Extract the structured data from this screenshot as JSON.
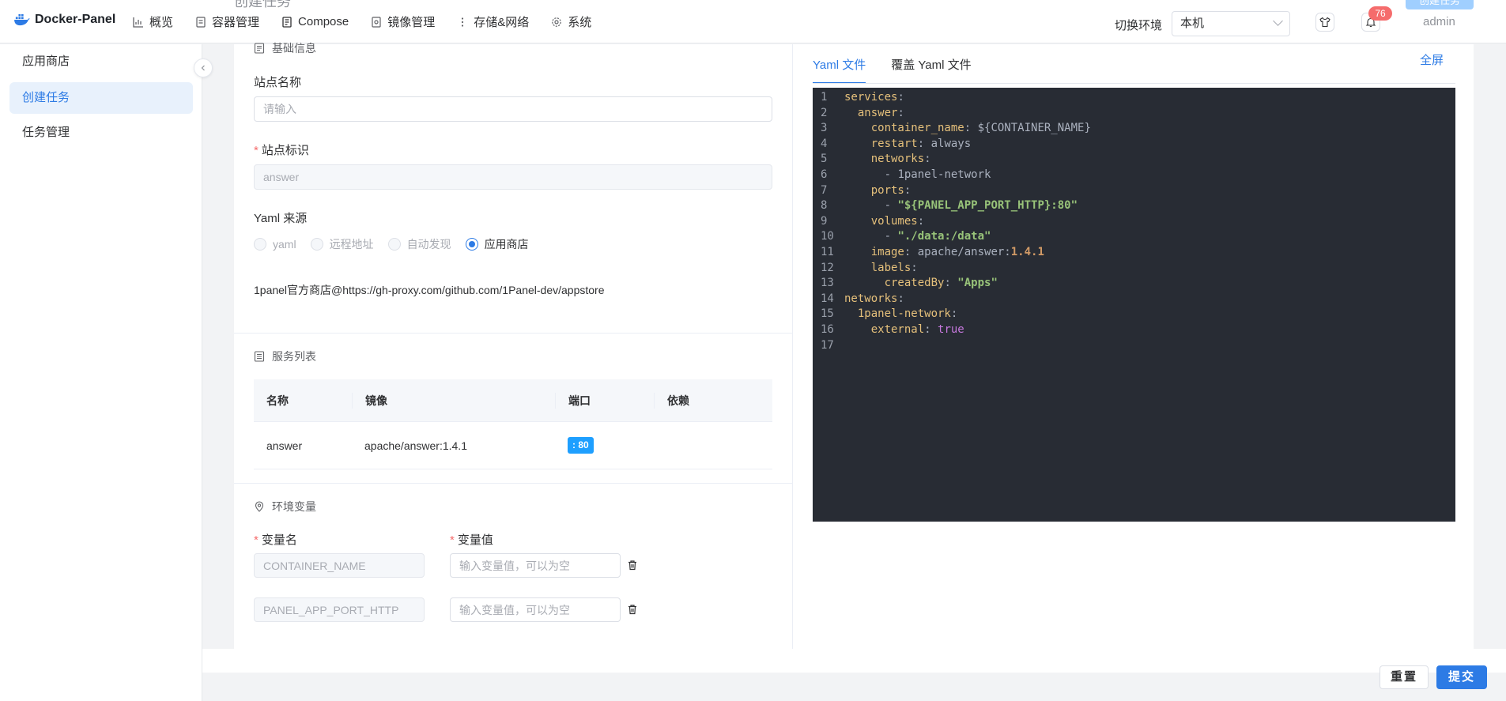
{
  "app": {
    "brand": "Docker-Panel",
    "page_title": "创建任务",
    "header_action": "创建任务"
  },
  "nav": [
    {
      "label": "概览",
      "icon": "chart-icon"
    },
    {
      "label": "容器管理",
      "icon": "container-icon"
    },
    {
      "label": "Compose",
      "icon": "compose-icon"
    },
    {
      "label": "镜像管理",
      "icon": "image-icon"
    },
    {
      "label": "存储&网络",
      "icon": "storage-icon"
    },
    {
      "label": "系统",
      "icon": "gear-icon"
    }
  ],
  "header": {
    "env_label": "切换环境",
    "env_value": "本机",
    "notification_count": "76",
    "user": "admin"
  },
  "sidebar": {
    "items": [
      {
        "label": "应用商店"
      },
      {
        "label": "创建任务"
      },
      {
        "label": "任务管理"
      }
    ]
  },
  "basic": {
    "section_title": "基础信息",
    "site_name_label": "站点名称",
    "site_name_placeholder": "请输入",
    "site_id_label": "站点标识",
    "site_id_value": "answer",
    "yaml_source_label": "Yaml 来源",
    "radios": [
      "yaml",
      "远程地址",
      "自动发现",
      "应用商店"
    ],
    "store_url": "1panel官方商店@https://gh-proxy.com/github.com/1Panel-dev/appstore"
  },
  "services": {
    "section_title": "服务列表",
    "headers": [
      "名称",
      "镜像",
      "端口",
      "依赖"
    ],
    "rows": [
      {
        "name": "answer",
        "image": "apache/answer:1.4.1",
        "port": ": 80",
        "depends": ""
      }
    ]
  },
  "env": {
    "section_title": "环境变量",
    "name_label": "变量名",
    "value_label": "变量值",
    "value_placeholder": "输入变量值，可以为空",
    "vars": [
      {
        "name": "CONTAINER_NAME"
      },
      {
        "name": "PANEL_APP_PORT_HTTP"
      }
    ]
  },
  "editor": {
    "tabs": [
      "Yaml 文件",
      "覆盖 Yaml 文件"
    ],
    "fullscreen": "全屏",
    "line_numbers": [
      "1",
      "2",
      "3",
      "4",
      "5",
      "6",
      "7",
      "8",
      "9",
      "10",
      "11",
      "12",
      "13",
      "14",
      "15",
      "16",
      "17"
    ],
    "code": {
      "l1": "services",
      "l2": "answer",
      "l3k": "container_name",
      "l3v": "${CONTAINER_NAME}",
      "l4k": "restart",
      "l4v": "always",
      "l5": "networks",
      "l6": "1panel-network",
      "l7": "ports",
      "l8": "\"${PANEL_APP_PORT_HTTP}:80\"",
      "l9": "volumes",
      "l10": "\"./data:/data\"",
      "l11k": "image",
      "l11v": "apache/answer:",
      "l11n": "1.4.1",
      "l12": "labels",
      "l13k": "createdBy",
      "l13v": "\"Apps\"",
      "l14": "networks",
      "l15": "1panel-network",
      "l16k": "external",
      "l16v": "true"
    }
  },
  "footer": {
    "reset": "重置",
    "submit": "提交"
  },
  "colors": {
    "primary": "#2d7be5",
    "editor_bg": "#282c34",
    "badge": "#f56c6c",
    "port_tag": "#1e9fff"
  }
}
